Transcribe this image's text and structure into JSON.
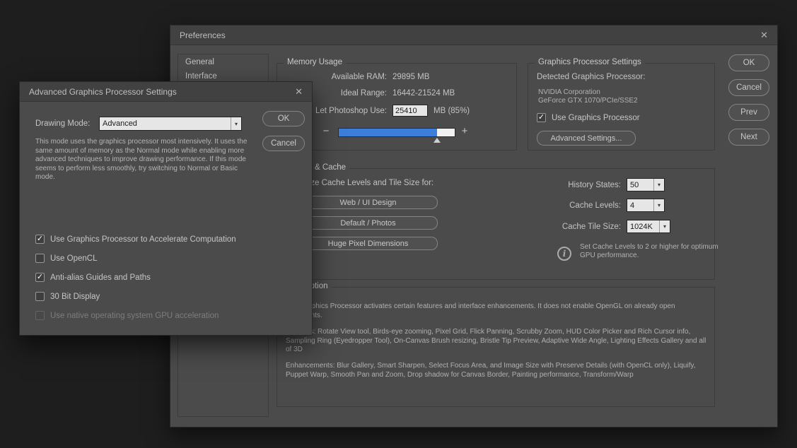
{
  "icons": {
    "close": "✕",
    "chevron_down": "▾",
    "check": "✓",
    "minus": "−",
    "plus": "+",
    "info": "i"
  },
  "preferences": {
    "title": "Preferences",
    "sidebar": [
      "General",
      "Interface"
    ],
    "memory": {
      "section_title": "Memory Usage",
      "available_ram_label": "Available RAM:",
      "available_ram_value": "29895 MB",
      "ideal_range_label": "Ideal Range:",
      "ideal_range_value": "16442-21524 MB",
      "let_use_label": "Let Photoshop Use:",
      "let_use_value": "25410",
      "let_use_suffix": "MB (85%)",
      "slider_percent": 85
    },
    "gpu": {
      "section_title": "Graphics Processor Settings",
      "detected_label": "Detected Graphics Processor:",
      "vendor": "NVIDIA Corporation",
      "model": "GeForce GTX 1070/PCIe/SSE2",
      "use_gpu_label": "Use Graphics Processor",
      "use_gpu_checked": true,
      "advanced_button": "Advanced Settings..."
    },
    "history_cache": {
      "section_title": "History & Cache",
      "optimize_label": "Optimize Cache Levels and Tile Size for:",
      "presets": [
        "Web / UI Design",
        "Default / Photos",
        "Huge Pixel Dimensions"
      ],
      "history_states_label": "History States:",
      "history_states_value": "50",
      "cache_levels_label": "Cache Levels:",
      "cache_levels_value": "4",
      "cache_tile_size_label": "Cache Tile Size:",
      "cache_tile_size_value": "1024K",
      "tip": "Set Cache Levels to 2 or higher for optimum GPU performance."
    },
    "description": {
      "section_title": "Description",
      "p1": "The Graphics Processor activates certain features and interface enhancements. It does not enable OpenGL on already open documents.",
      "p2": "Features: Rotate View tool, Birds-eye zooming, Pixel Grid, Flick Panning, Scrubby Zoom, HUD Color Picker and Rich Cursor info, Sampling Ring (Eyedropper Tool), On-Canvas Brush resizing, Bristle Tip Preview, Adaptive Wide Angle, Lighting Effects Gallery and all of 3D",
      "p3": "Enhancements: Blur Gallery, Smart Sharpen, Select Focus Area, and Image Size with Preserve Details (with OpenCL only), Liquify, Puppet Warp, Smooth Pan and Zoom, Drop shadow for Canvas Border, Painting performance, Transform/Warp"
    },
    "buttons": {
      "ok": "OK",
      "cancel": "Cancel",
      "prev": "Prev",
      "next": "Next"
    }
  },
  "advanced_dialog": {
    "title": "Advanced Graphics Processor Settings",
    "drawing_mode_label": "Drawing Mode:",
    "drawing_mode_value": "Advanced",
    "description": "This mode uses the graphics processor most intensively.  It uses the same amount of memory as the Normal mode while enabling more advanced techniques to improve drawing performance.  If this mode seems to perform less smoothly, try switching to Normal or Basic mode.",
    "ok": "OK",
    "cancel": "Cancel",
    "checkboxes": [
      {
        "label": "Use Graphics Processor to Accelerate Computation",
        "checked": true,
        "enabled": true
      },
      {
        "label": "Use OpenCL",
        "checked": false,
        "enabled": true
      },
      {
        "label": "Anti-alias Guides and Paths",
        "checked": true,
        "enabled": true
      },
      {
        "label": "30 Bit Display",
        "checked": false,
        "enabled": true
      },
      {
        "label": "Use native operating system GPU acceleration",
        "checked": false,
        "enabled": false
      }
    ]
  }
}
